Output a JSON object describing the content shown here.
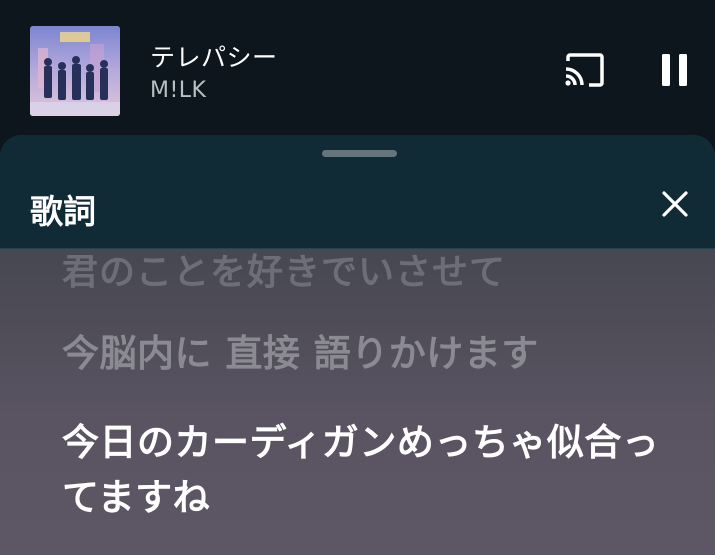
{
  "now_playing": {
    "title": "テレパシー",
    "artist": "M!LK",
    "album_art": "album-cover-group-photo"
  },
  "controls": {
    "cast_icon": "cast-icon",
    "pause_icon": "pause-icon"
  },
  "lyrics_sheet": {
    "title": "歌詞",
    "close_icon": "close-icon",
    "lines": {
      "previous_faded": "君のことを好きでいさせて",
      "previous": "今脳内に 直接 語りかけます",
      "current": "今日のカーディガンめっちゃ似合ってますね"
    }
  },
  "colors": {
    "background": "#0c161c",
    "sheet_header": "#102a36",
    "active_lyric": "#ffffff",
    "dim_lyric": "#8b8a93"
  }
}
